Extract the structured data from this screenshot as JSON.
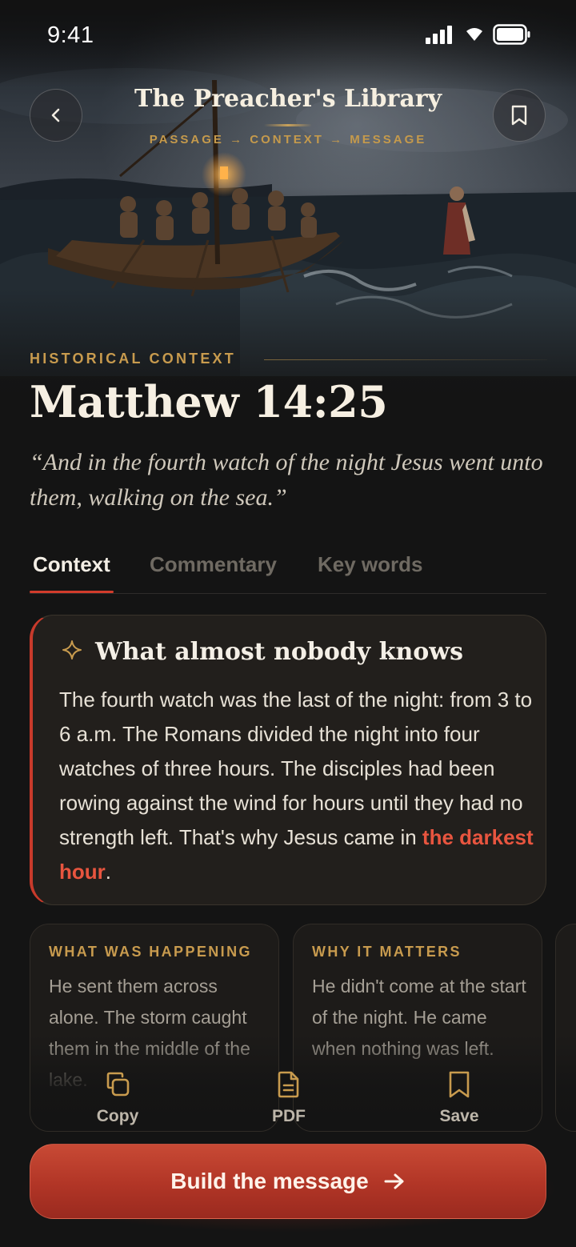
{
  "status_bar": {
    "time": "9:41"
  },
  "header": {
    "app_title": "The Preacher's Library",
    "breadcrumb": "PASSAGE → CONTEXT → MESSAGE",
    "back_icon": "chevron-left-icon",
    "bookmark_icon": "bookmark-icon"
  },
  "passage": {
    "section_label": "HISTORICAL CONTEXT",
    "reference": "Matthew 14:25",
    "verse": "“And in the fourth watch of the night Jesus went unto them, walking on the sea.”"
  },
  "tabs": [
    {
      "label": "Context",
      "active": true
    },
    {
      "label": "Commentary",
      "active": false
    },
    {
      "label": "Key words",
      "active": false
    }
  ],
  "insight": {
    "icon": "sparkle-icon",
    "title": "What almost nobody knows",
    "body": "The fourth watch was the last of the night: from 3 to 6 a.m. The Romans divided the night into four watches of three hours. The disciples had been rowing against the wind for hours until they had no strength left. That's why Jesus came in ",
    "highlight": "the darkest hour",
    "end": "."
  },
  "cards": [
    {
      "label": "WHAT WAS HAPPENING",
      "text": "He sent them across alone. The storm caught them in the middle of the lake."
    },
    {
      "label": "WHY IT MATTERS",
      "text": "He didn't come at the start of the night. He came when nothing was left."
    }
  ],
  "actions": [
    {
      "label": "Copy",
      "icon": "copy-icon"
    },
    {
      "label": "PDF",
      "icon": "document-icon"
    },
    {
      "label": "Save",
      "icon": "bookmark-icon"
    }
  ],
  "cta": {
    "label": "Build the message",
    "icon": "arrow-right-icon"
  },
  "colors": {
    "accent": "#c83a2b",
    "gold": "#c89b4e",
    "background": "#141414"
  }
}
